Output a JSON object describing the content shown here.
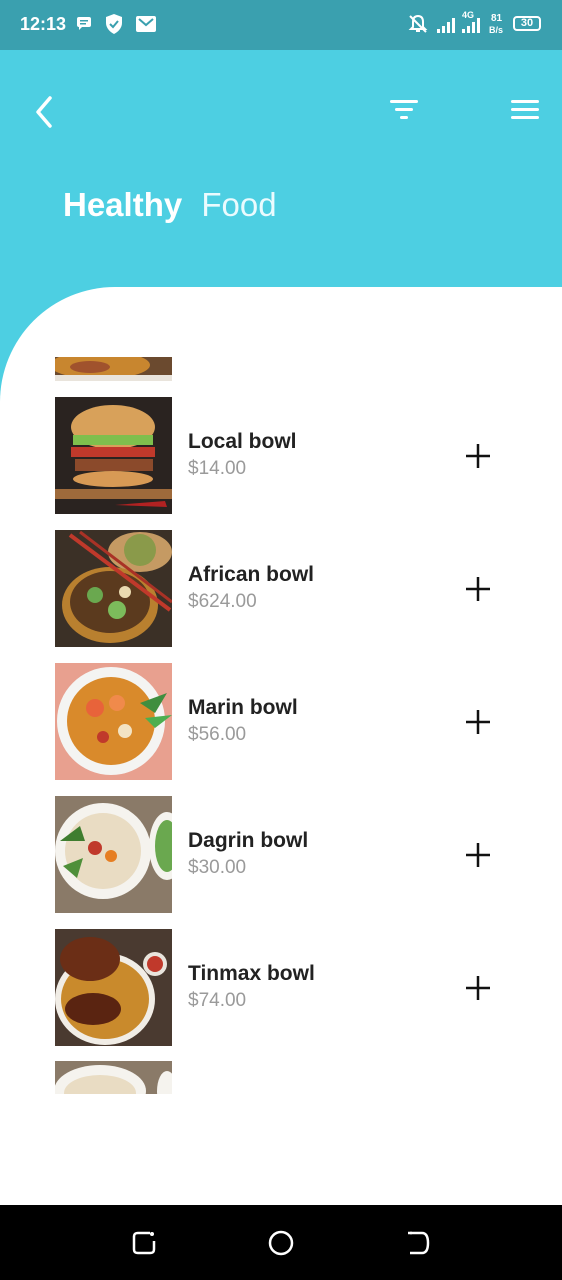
{
  "status_bar": {
    "time": "12:13",
    "battery": "30",
    "net_speed_top": "81",
    "net_speed_bottom": "B/s",
    "network": "4G"
  },
  "header": {
    "title_bold": "Healthy",
    "title_light": "Food"
  },
  "colors": {
    "header": "#4dcfe2",
    "status": "#3aa0af",
    "price": "#9a9a9a"
  },
  "items": [
    {
      "name": "Local bowl",
      "price": "$14.00"
    },
    {
      "name": "African bowl",
      "price": "$624.00"
    },
    {
      "name": "Marin bowl",
      "price": "$56.00"
    },
    {
      "name": "Dagrin bowl",
      "price": "$30.00"
    },
    {
      "name": "Tinmax bowl",
      "price": "$74.00"
    }
  ]
}
